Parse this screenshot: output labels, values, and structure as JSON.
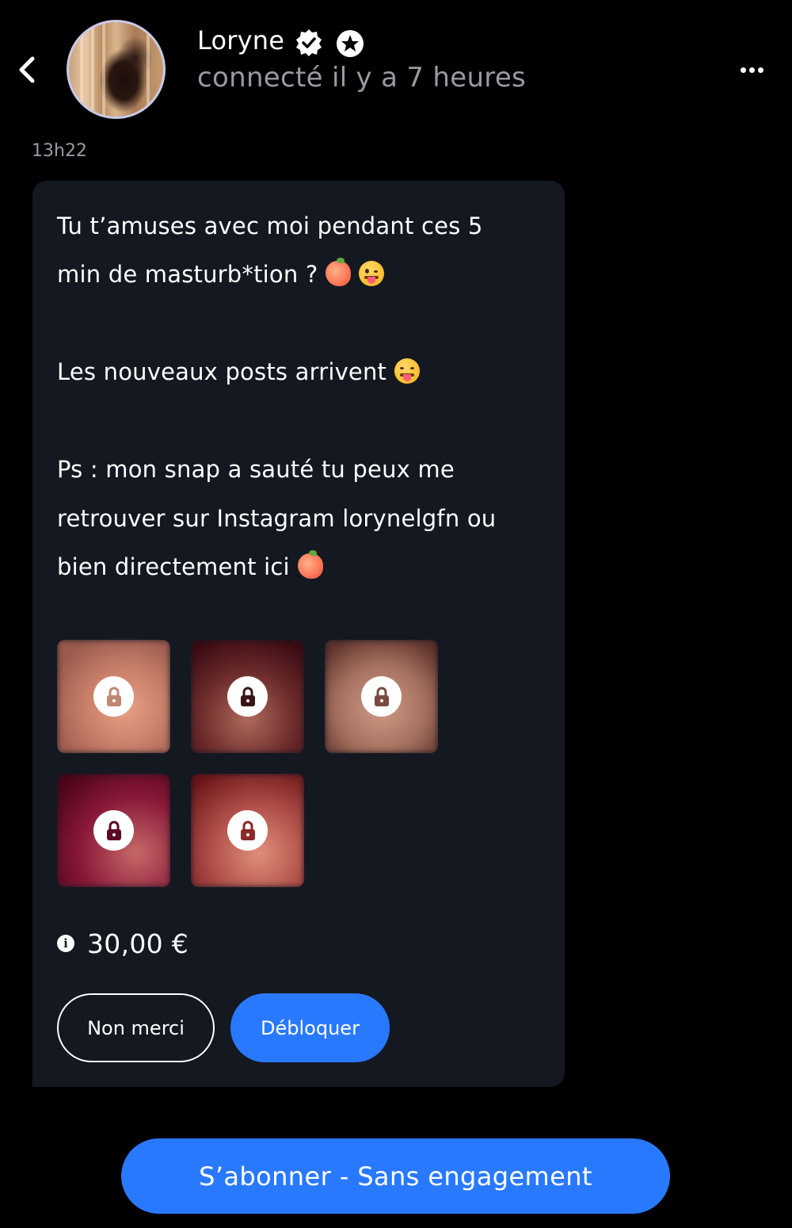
{
  "header": {
    "back_icon": "chevron-left-icon",
    "user_name": "Loryne",
    "badges": [
      "verified-icon",
      "star-icon"
    ],
    "status": "connecté il y a 7 heures",
    "more_icon": "more-horizontal-icon"
  },
  "message": {
    "time": "13h22",
    "lines": [
      "Tu t’amuses avec moi pendant ces 5",
      "min de masturb*tion ?",
      "Les nouveaux posts arrivent",
      "Ps : mon snap a sauté tu peux me",
      "retrouver sur Instagram lorynelgfn ou",
      "bien directement ici"
    ],
    "locked_media_count": 5,
    "price": "30,00 €",
    "decline_label": "Non merci",
    "unlock_label": "Débloquer"
  },
  "footer": {
    "subscribe_label": "S’abonner - Sans engagement"
  },
  "colors": {
    "accent": "#2979ff",
    "bubble": "#141821",
    "background": "#000000",
    "muted_text": "#9a9aa4"
  }
}
